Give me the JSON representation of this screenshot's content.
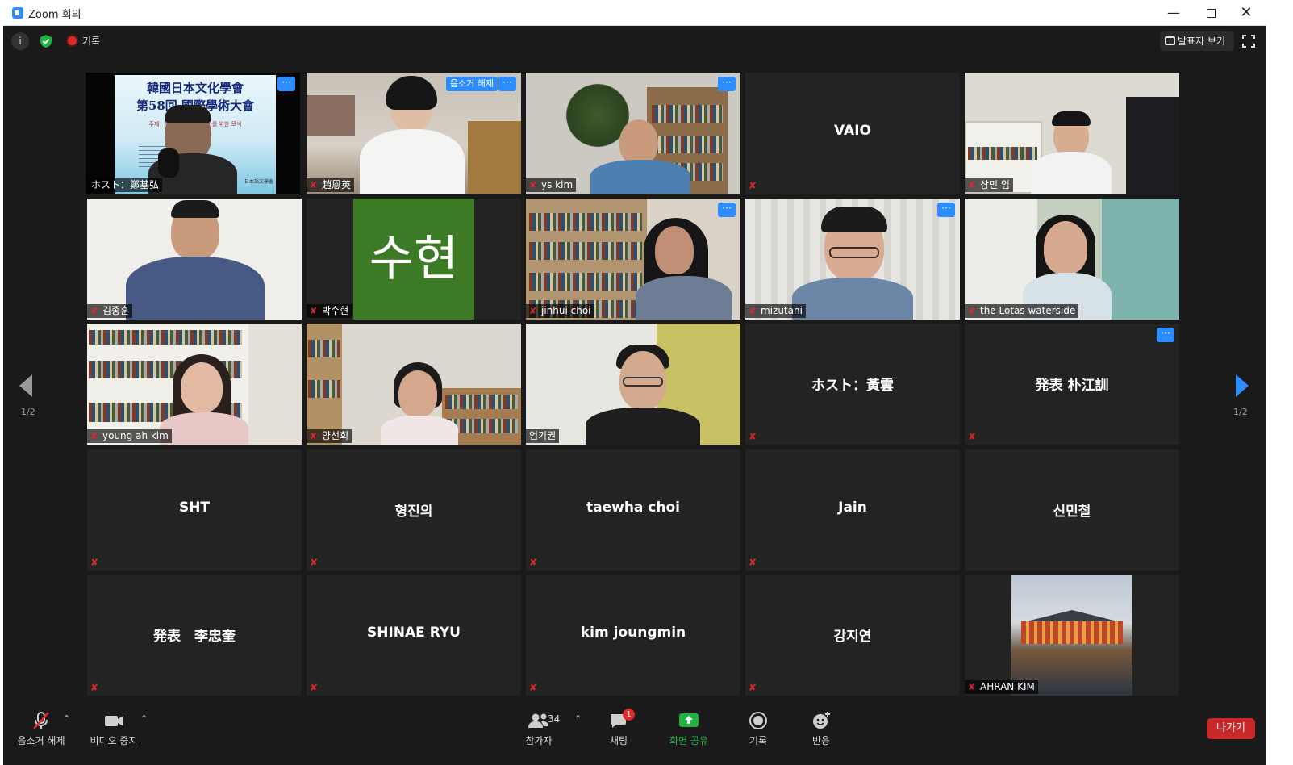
{
  "window": {
    "title": "Zoom 회의"
  },
  "topbar": {
    "record_label": "기록",
    "speaker_view_label": "발표자 보기"
  },
  "pagination": {
    "left_page": "1/2",
    "right_page": "1/2"
  },
  "tiles": [
    {
      "name": "ホスト：鄭基弘",
      "slide_title_1": "韓國日本文化學會",
      "slide_title_2": "第58回 國際學術大會",
      "slide_theme": "주제：한국 대학 ... 활성화를 위한 모색",
      "slide_footer": "日本語文學會"
    },
    {
      "name": "趙恩英",
      "unmute_label": "음소거 해제"
    },
    {
      "name": "ys kim"
    },
    {
      "name": "VAIO"
    },
    {
      "name": "상민 임"
    },
    {
      "name": "김종훈"
    },
    {
      "name": "박수현",
      "avatar_text": "수현"
    },
    {
      "name": "jinhui choi"
    },
    {
      "name": "mizutani"
    },
    {
      "name": "the Lotas waterside"
    },
    {
      "name": "young ah kim"
    },
    {
      "name": "양선희"
    },
    {
      "name": "엄기권"
    },
    {
      "name": "ホスト：黃雲"
    },
    {
      "name": "発表 朴江訓"
    },
    {
      "name": "SHT"
    },
    {
      "name": "형진의"
    },
    {
      "name": "taewha choi"
    },
    {
      "name": "Jain"
    },
    {
      "name": "신민철"
    },
    {
      "name": "発表　李忠奎"
    },
    {
      "name": "SHINAE RYU"
    },
    {
      "name": "kim joungmin"
    },
    {
      "name": "강지연"
    },
    {
      "name": "AHRAN KIM"
    }
  ],
  "toolbar": {
    "unmute_label": "음소거 해제",
    "video_label": "비디오 중지",
    "participants_label": "참가자",
    "participants_count": "34",
    "chat_label": "채팅",
    "chat_badge": "1",
    "share_label": "화면 공유",
    "record_label": "기록",
    "reactions_label": "반응",
    "leave_label": "나가기"
  },
  "colors": {
    "accent": "#2d8cff",
    "active_speaker": "#f5ee4a",
    "muted": "#e02828",
    "share_green": "#1fb141",
    "leave_red": "#c8282a"
  }
}
